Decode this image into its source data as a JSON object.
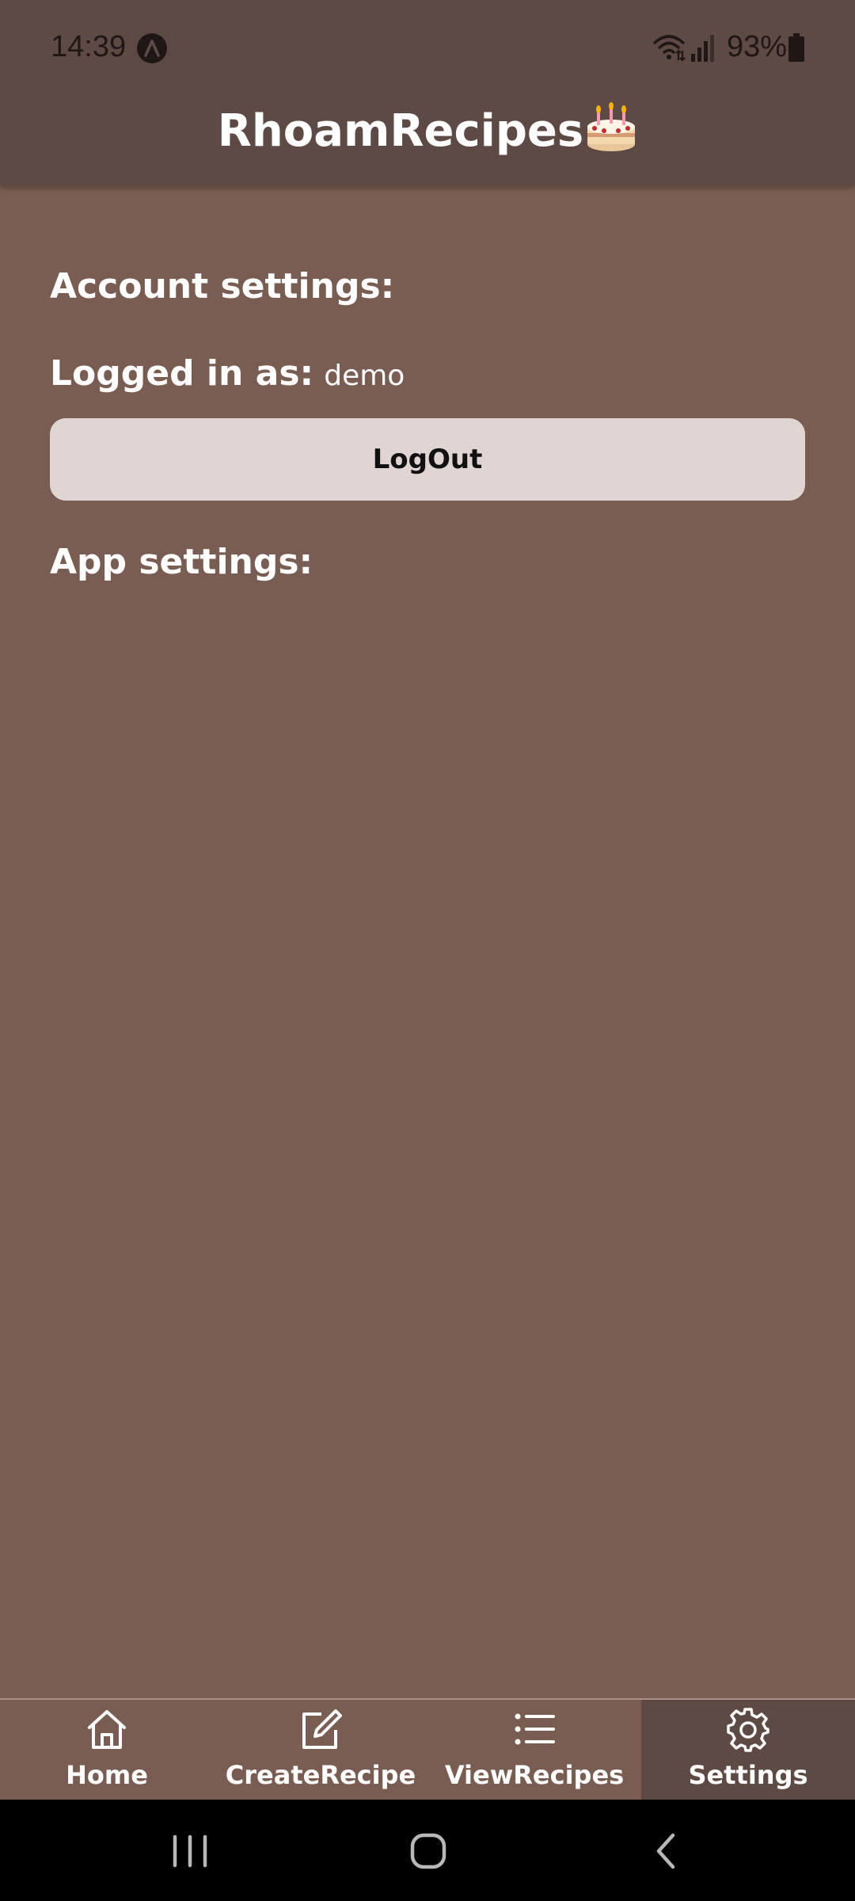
{
  "status_bar": {
    "time": "14:39",
    "battery": "93%",
    "icons": [
      "app-notification-icon",
      "wifi-icon",
      "signal-icon",
      "battery-icon"
    ]
  },
  "header": {
    "title": "RhoamRecipes",
    "title_icon": "cake-icon"
  },
  "account": {
    "heading": "Account settings:",
    "logged_in_label": "Logged in as:",
    "username": "demo",
    "logout_label": "LogOut"
  },
  "app_settings": {
    "heading": "App settings:"
  },
  "tabs": [
    {
      "label": "Home",
      "icon": "home-icon",
      "active": false
    },
    {
      "label": "CreateRecipe",
      "icon": "edit-icon",
      "active": false
    },
    {
      "label": "ViewRecipes",
      "icon": "list-icon",
      "active": false
    },
    {
      "label": "Settings",
      "icon": "gear-icon",
      "active": true
    }
  ],
  "system_nav": {
    "buttons": [
      "recent-apps-icon",
      "home-circle-icon",
      "back-icon"
    ]
  },
  "colors": {
    "background": "#795d52",
    "header": "#5e4a44",
    "button": "#dfd5d2",
    "active_tab": "#5e4a44",
    "system_nav": "#000000"
  }
}
